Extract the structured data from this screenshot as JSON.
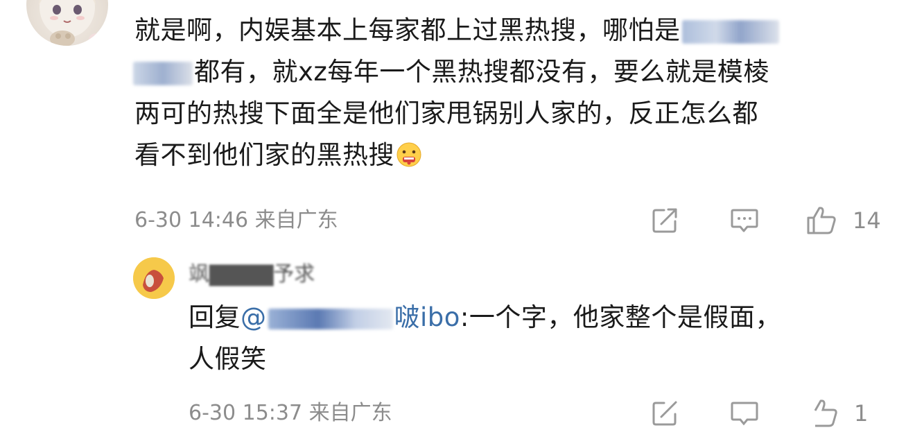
{
  "comment": {
    "line1_prefix": "就是啊，内娱基本上每家都上过黑热搜，哪怕是",
    "line2_suffix": "都有，就xz每年一个黑热搜都没有，要么就是模棱",
    "line3": "两可的热搜下面全是他们家甩锅别人家的，反正怎么都",
    "line4": "看不到他们家的黑热搜",
    "emoji": "grimacing-face",
    "time": "6-30 14:46 来自广东",
    "like_count": "14"
  },
  "reply": {
    "username": "飒▇▇▇▇予求",
    "line1_prefix": "回复",
    "mention_start": "@",
    "mention_end": "啵ibo",
    "line1_suffix": ":一个字，他家整个是假面，",
    "line2": "人假笑",
    "time": "6-30 15:37 来自广东",
    "like_count": "1"
  },
  "colors": {
    "text": "#1a1a1a",
    "meta": "#8c8c8c",
    "link": "#3a6ea8",
    "icon": "#9a9a9a"
  }
}
